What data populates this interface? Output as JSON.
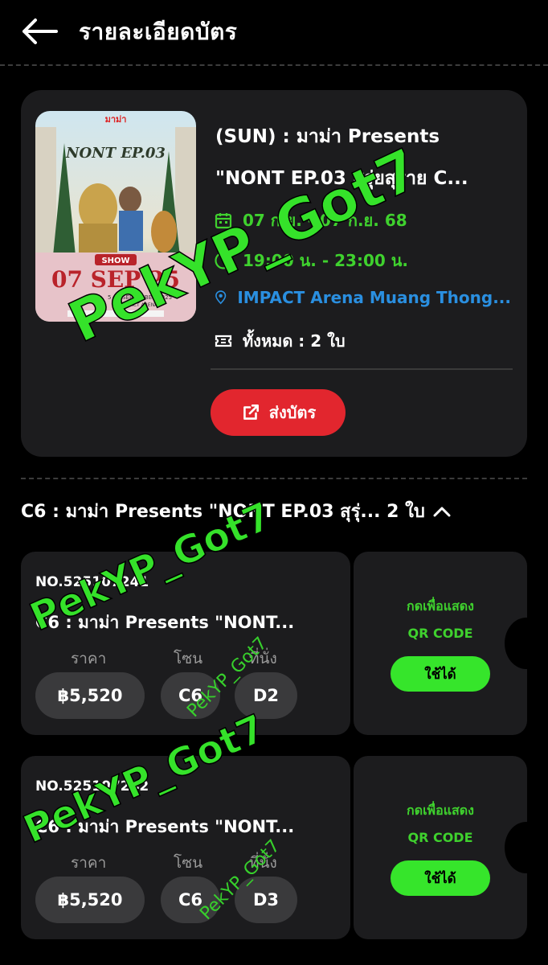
{
  "header": {
    "title": "รายละเอียดบัตร",
    "back_icon": "arrow-left-icon"
  },
  "event": {
    "poster": {
      "brand": "มาม่า",
      "show_label": "SHOW",
      "show_date": "07 SEP 25",
      "sub_date": "5 - 7 SEPTEMBER 2025",
      "venue_small": "IMPACT ARENA"
    },
    "day_line": "(SUN) : มาม่า Presents",
    "name_line": "\"NONT EP.03 สุรุ่ยสุร่าย C...",
    "date_text": "07 ก.ย. - 07 ก.ย. 68",
    "time_text": "19:00 น. - 23:00 น.",
    "venue_text": "IMPACT Arena Muang Thong...",
    "total_text": "ทั้งหมด : 2 ใบ",
    "send_button": "ส่งบัตร"
  },
  "section": {
    "title": "C6  : มาม่า Presents \"NONT EP.03 สุรุ่... 2 ใบ"
  },
  "labels": {
    "price": "ราคา",
    "zone": "โซน",
    "seat": "ที่นั่ง"
  },
  "tickets": [
    {
      "number": "NO.525107241",
      "name": "C6 : มาม่า Presents \"NONT...",
      "price": "฿5,520",
      "zone": "C6",
      "seat": "D2",
      "qr_line1": "กดเพื่อแสดง",
      "qr_line2": "QR CODE",
      "status": "ใช้ได้"
    },
    {
      "number": "NO.525107242",
      "name": "C6 : มาม่า Presents \"NONT...",
      "price": "฿5,520",
      "zone": "C6",
      "seat": "D3",
      "qr_line1": "กดเพื่อแสดง",
      "qr_line2": "QR CODE",
      "status": "ใช้ได้"
    }
  ],
  "watermark": "PekYP_Got7",
  "colors": {
    "accent_green": "#3fd12e",
    "button_green": "#36e52b",
    "send_red": "#e2262e",
    "venue_blue": "#2a8fe0"
  }
}
